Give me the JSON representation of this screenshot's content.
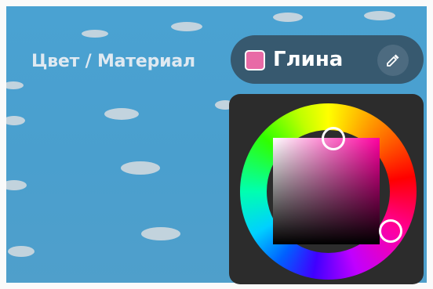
{
  "header": {
    "label": "Цвет / Материал"
  },
  "material": {
    "name": "Глина",
    "swatch_color": "#e86aa6"
  },
  "eyedropper": {
    "icon": "eyedropper-icon"
  },
  "picker": {
    "hue_icon": "hue-wheel",
    "accent_hue": "#ff00a0"
  }
}
